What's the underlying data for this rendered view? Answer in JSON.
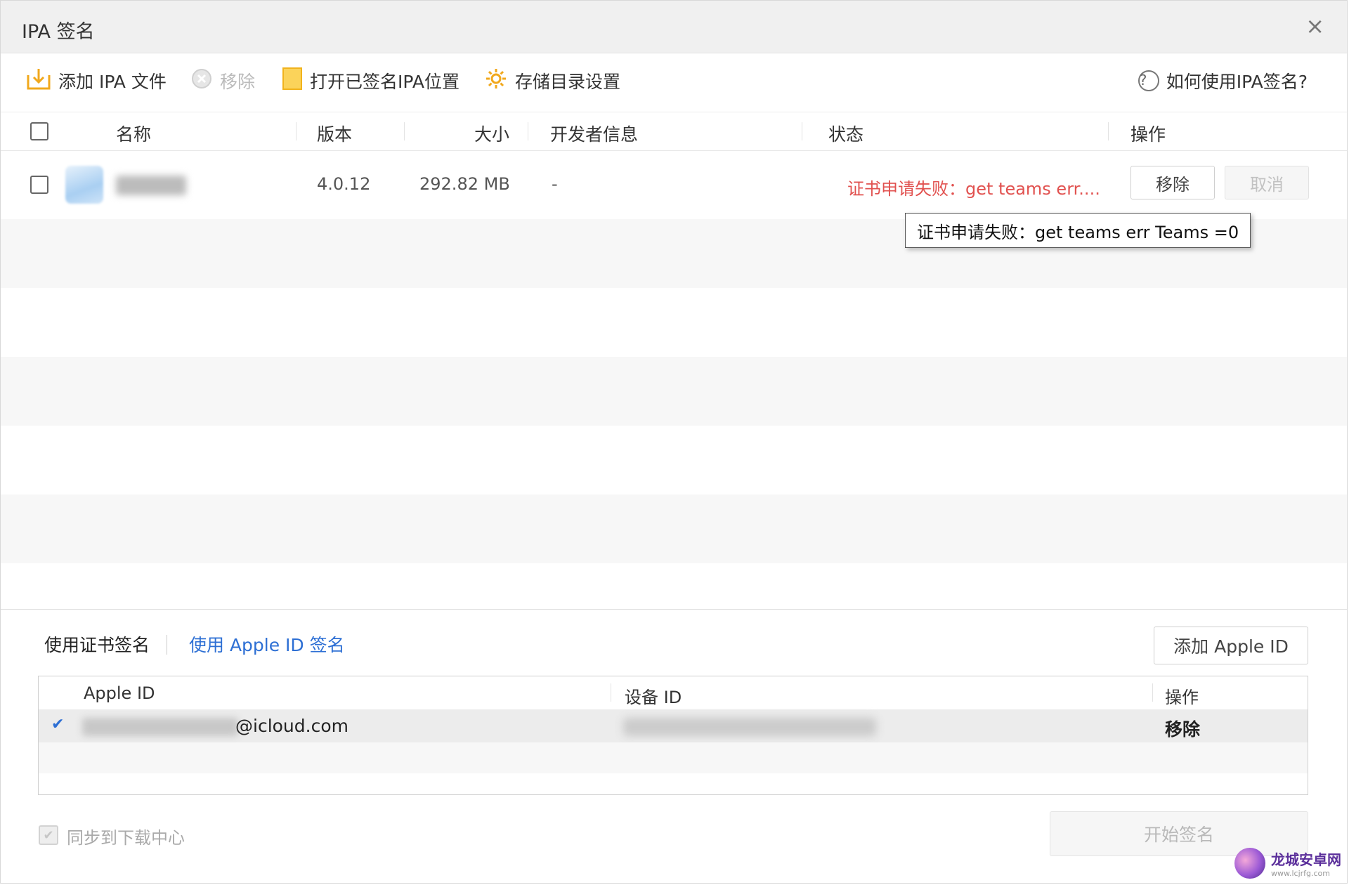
{
  "window": {
    "title": "IPA 签名",
    "close": "×"
  },
  "toolbar": {
    "add_ipa": "添加 IPA 文件",
    "remove": "移除",
    "open_signed": "打开已签名IPA位置",
    "storage_settings": "存储目录设置",
    "help": "如何使用IPA签名?"
  },
  "table": {
    "headers": {
      "name": "名称",
      "version": "版本",
      "size": "大小",
      "developer": "开发者信息",
      "status": "状态",
      "action": "操作"
    },
    "rows": [
      {
        "version": "4.0.12",
        "size": "292.82 MB",
        "developer": "-",
        "status": "证书申请失败：get teams err....",
        "remove_label": "移除",
        "cancel_label": "取消"
      }
    ]
  },
  "tooltip": {
    "text": "证书申请失败：get teams err Teams =0"
  },
  "sign_mode": {
    "tab_cert": "使用证书签名",
    "tab_apple_id": "使用 Apple ID 签名",
    "add_apple_id": "添加 Apple ID"
  },
  "apple_id_table": {
    "headers": {
      "apple_id": "Apple ID",
      "device_id": "设备 ID",
      "action": "操作"
    },
    "rows": [
      {
        "check": "✔",
        "email_suffix": "@icloud.com",
        "action": "移除"
      }
    ]
  },
  "footer": {
    "sync_label": "同步到下载中心",
    "start_sign": "开始签名"
  },
  "watermark": {
    "name": "龙城安卓网",
    "url": "www.lcjrfg.com"
  }
}
